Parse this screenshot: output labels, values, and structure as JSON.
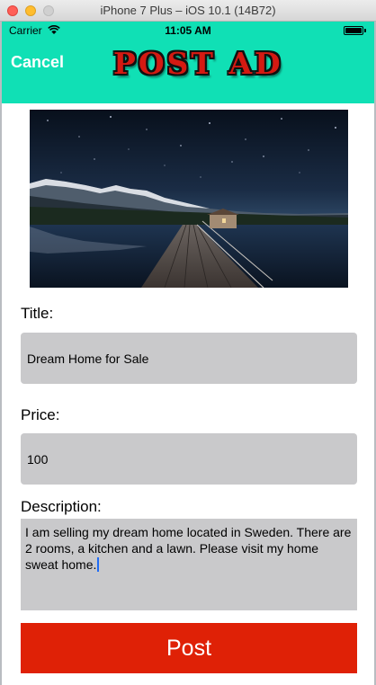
{
  "window": {
    "title": "iPhone 7 Plus – iOS 10.1 (14B72)"
  },
  "status_bar": {
    "carrier": "Carrier",
    "time": "11:05 AM"
  },
  "nav": {
    "cancel_label": "Cancel",
    "title": "POST AD"
  },
  "form": {
    "title_label": "Title:",
    "title_value": "Dream Home for Sale",
    "price_label": "Price:",
    "price_value": "100",
    "description_label": "Description:",
    "description_value": "I am selling my dream home located in Sweden. There are 2 rooms, a kitchen and a lawn. Please visit my home sweat home."
  },
  "post_button_label": "Post",
  "colors": {
    "nav_background": "#10e0b5",
    "post_button": "#df2106",
    "field_background": "#c9c9cb"
  }
}
